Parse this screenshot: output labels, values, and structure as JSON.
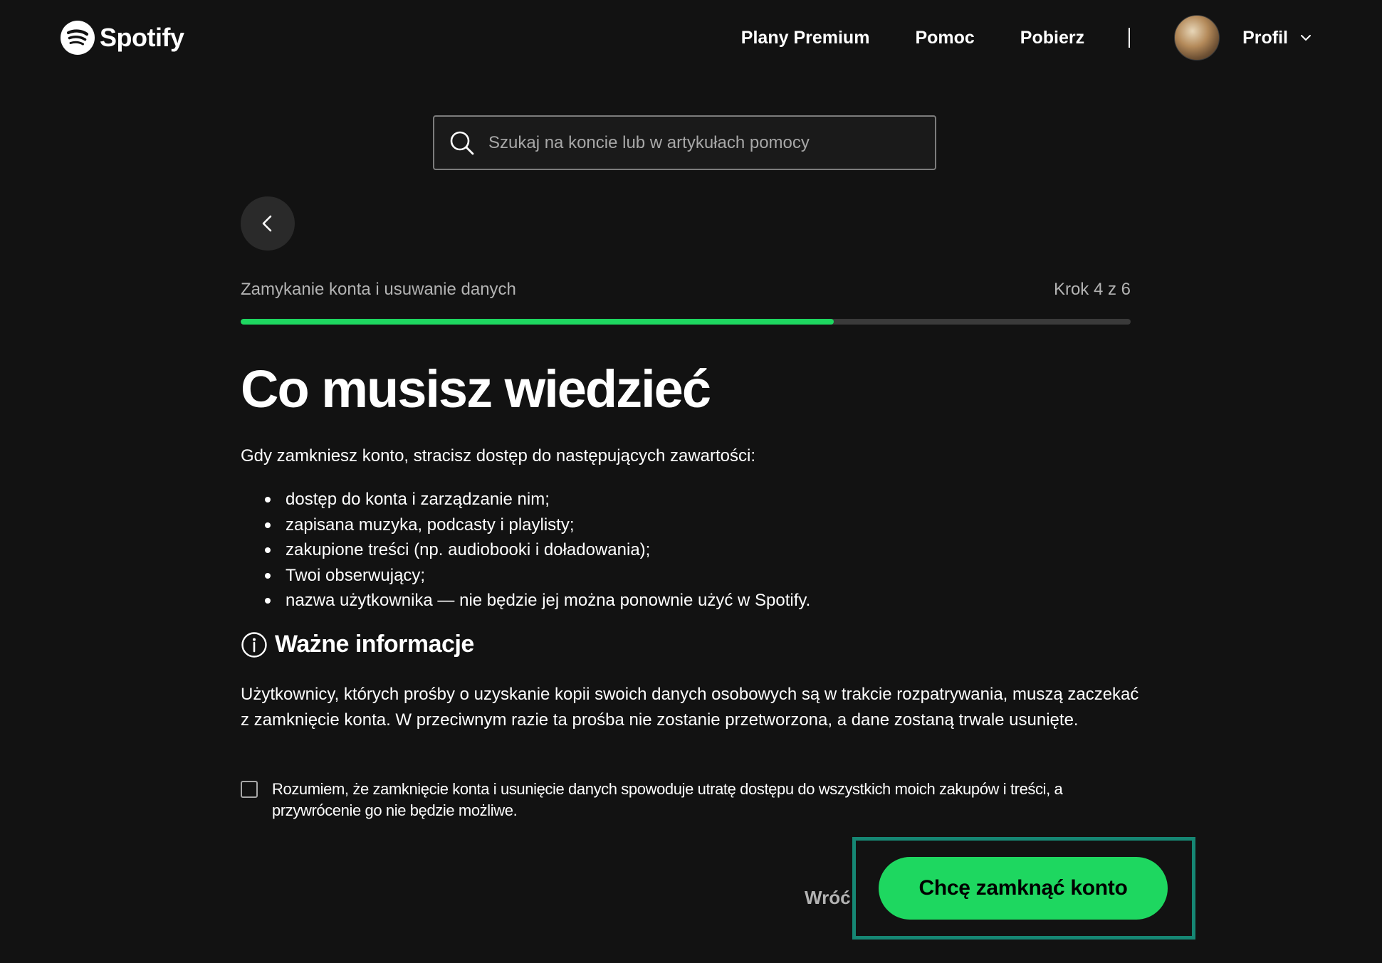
{
  "header": {
    "brand": "Spotify",
    "nav": [
      "Plany Premium",
      "Pomoc",
      "Pobierz"
    ],
    "profile_label": "Profil"
  },
  "search": {
    "placeholder": "Szukaj na koncie lub w artykułach pomocy",
    "value": ""
  },
  "flow": {
    "name": "Zamykanie konta i usuwanie danych",
    "step_label": "Krok 4 z 6",
    "current_step": 4,
    "total_steps": 6
  },
  "content": {
    "title": "Co musisz wiedzieć",
    "intro": "Gdy zamkniesz konto, stracisz dostęp do następujących zawartości:",
    "bullets": [
      "dostęp do konta i zarządzanie nim;",
      "zapisana muzyka, podcasty i playlisty;",
      "zakupione treści (np. audiobooki i doładowania);",
      "Twoi obserwujący;",
      "nazwa użytkownika — nie będzie jej można ponownie użyć w Spotify."
    ],
    "important_heading": "Ważne informacje",
    "important_text": "Użytkownicy, których prośby o uzyskanie kopii swoich danych osobowych są w trakcie rozpatrywania, muszą zaczekać z zamknięcie konta. W przeciwnym razie ta prośba nie zostanie przetworzona, a dane zostaną trwale usunięte.",
    "consent_text": "Rozumiem, że zamknięcie konta i usunięcie danych spowoduje utratę dostępu do wszystkich moich zakupów i treści, a przywrócenie go nie będzie możliwe.",
    "consent_checked": false
  },
  "actions": {
    "back_label": "Wróć",
    "confirm_label": "Chcę zamknąć konto"
  },
  "colors": {
    "background": "#121212",
    "accent_green": "#1ed760",
    "highlight_border": "#168774"
  },
  "icons": [
    "spotify-logo-icon",
    "chevron-down-icon",
    "search-icon",
    "chevron-left-icon",
    "info-icon"
  ]
}
